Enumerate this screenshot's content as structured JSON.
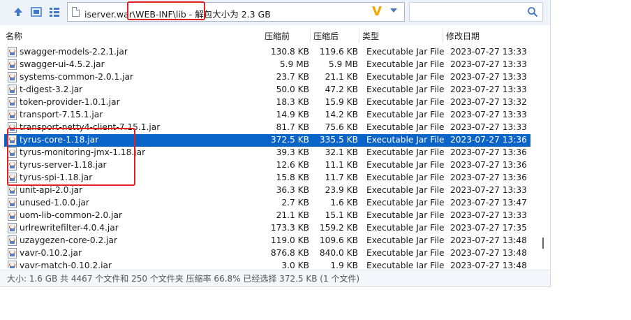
{
  "toolbar": {
    "address": "iserver.war\\WEB-INF\\lib - 解包大小为 2.3 GB",
    "search_placeholder": ""
  },
  "columns": {
    "name": "名称",
    "packed": "压缩前",
    "unpacked": "压缩后",
    "type": "类型",
    "modified": "修改日期"
  },
  "files": [
    {
      "name": "swagger-models-2.2.1.jar",
      "packed": "130.8 KB",
      "unpacked": "119.6 KB",
      "type": "Executable Jar File",
      "modified": "2023-07-27 13:33"
    },
    {
      "name": "swagger-ui-4.5.2.jar",
      "packed": "5.9 MB",
      "unpacked": "5.9 MB",
      "type": "Executable Jar File",
      "modified": "2023-07-27 13:33"
    },
    {
      "name": "systems-common-2.0.1.jar",
      "packed": "23.7 KB",
      "unpacked": "21.1 KB",
      "type": "Executable Jar File",
      "modified": "2023-07-27 13:33"
    },
    {
      "name": "t-digest-3.2.jar",
      "packed": "50.0 KB",
      "unpacked": "47.2 KB",
      "type": "Executable Jar File",
      "modified": "2023-07-27 13:33"
    },
    {
      "name": "token-provider-1.0.1.jar",
      "packed": "18.3 KB",
      "unpacked": "15.9 KB",
      "type": "Executable Jar File",
      "modified": "2023-07-27 13:32"
    },
    {
      "name": "transport-7.15.1.jar",
      "packed": "14.9 KB",
      "unpacked": "14.2 KB",
      "type": "Executable Jar File",
      "modified": "2023-07-27 13:33"
    },
    {
      "name": "transport-netty4-client-7.15.1.jar",
      "packed": "81.7 KB",
      "unpacked": "75.6 KB",
      "type": "Executable Jar File",
      "modified": "2023-07-27 13:33"
    },
    {
      "name": "tyrus-core-1.18.jar",
      "packed": "372.5 KB",
      "unpacked": "335.5 KB",
      "type": "Executable Jar File",
      "modified": "2023-07-27 13:36"
    },
    {
      "name": "tyrus-monitoring-jmx-1.18.jar",
      "packed": "39.3 KB",
      "unpacked": "32.1 KB",
      "type": "Executable Jar File",
      "modified": "2023-07-27 13:36"
    },
    {
      "name": "tyrus-server-1.18.jar",
      "packed": "12.6 KB",
      "unpacked": "11.1 KB",
      "type": "Executable Jar File",
      "modified": "2023-07-27 13:36"
    },
    {
      "name": "tyrus-spi-1.18.jar",
      "packed": "15.8 KB",
      "unpacked": "11.7 KB",
      "type": "Executable Jar File",
      "modified": "2023-07-27 13:36"
    },
    {
      "name": "unit-api-2.0.jar",
      "packed": "36.3 KB",
      "unpacked": "23.9 KB",
      "type": "Executable Jar File",
      "modified": "2023-07-27 13:33"
    },
    {
      "name": "unused-1.0.0.jar",
      "packed": "2.7 KB",
      "unpacked": "1.6 KB",
      "type": "Executable Jar File",
      "modified": "2023-07-27 13:47"
    },
    {
      "name": "uom-lib-common-2.0.jar",
      "packed": "21.1 KB",
      "unpacked": "15.1 KB",
      "type": "Executable Jar File",
      "modified": "2023-07-27 13:33"
    },
    {
      "name": "urlrewritefilter-4.0.4.jar",
      "packed": "173.3 KB",
      "unpacked": "159.2 KB",
      "type": "Executable Jar File",
      "modified": "2023-07-27 17:35"
    },
    {
      "name": "uzaygezen-core-0.2.jar",
      "packed": "119.0 KB",
      "unpacked": "109.6 KB",
      "type": "Executable Jar File",
      "modified": "2023-07-27 13:48"
    },
    {
      "name": "vavr-0.10.2.jar",
      "packed": "876.8 KB",
      "unpacked": "840.0 KB",
      "type": "Executable Jar File",
      "modified": "2023-07-27 13:48"
    },
    {
      "name": "vavr-match-0.10.2.jar",
      "packed": "3.0 KB",
      "unpacked": "1.9 KB",
      "type": "Executable Jar File",
      "modified": "2023-07-27 13:48"
    }
  ],
  "selected_index": 7,
  "status": "大小: 1.6 GB 共 4467 个文件和 250 个文件夹 压缩率 66.8% 已经选择 372.5 KB (1 个文件)",
  "colors": {
    "selection": "#0a64c8",
    "highlight_box": "#e02020",
    "toolbar_bg": "#eef3fa"
  }
}
